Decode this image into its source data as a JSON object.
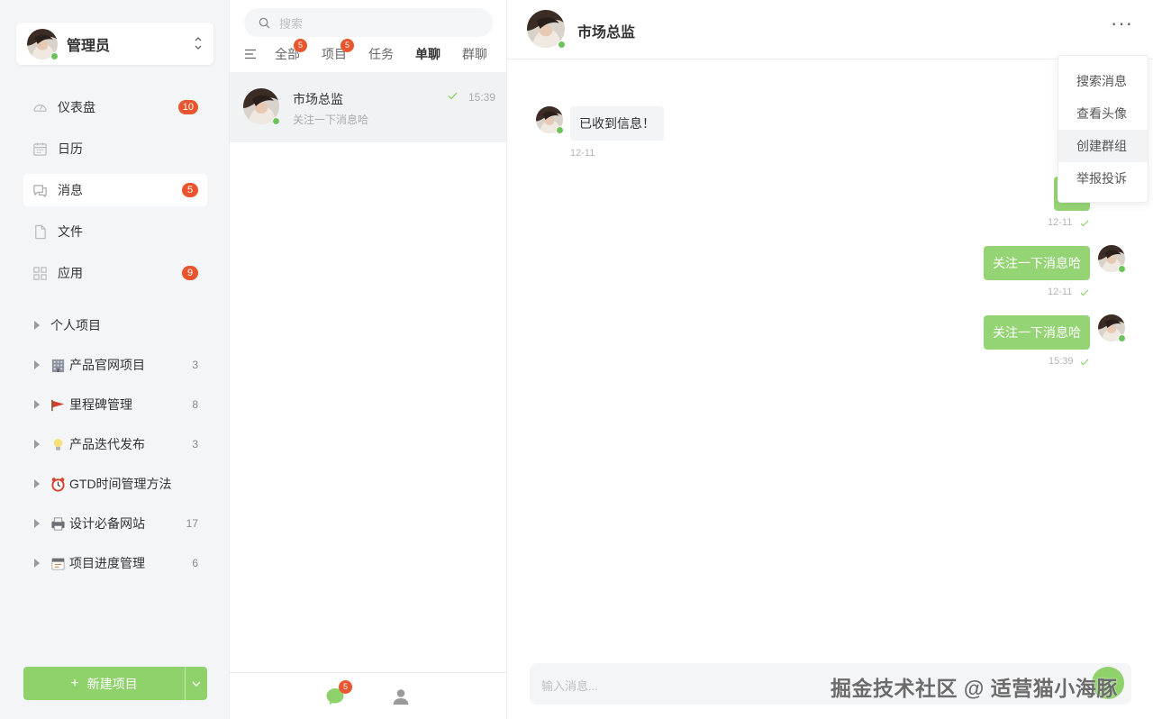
{
  "user": {
    "name": "管理员"
  },
  "nav": [
    {
      "label": "仪表盘",
      "icon": "dashboard-icon",
      "badge": "10"
    },
    {
      "label": "日历",
      "icon": "calendar-icon",
      "badge": ""
    },
    {
      "label": "消息",
      "icon": "message-icon",
      "badge": "5"
    },
    {
      "label": "文件",
      "icon": "file-icon",
      "badge": ""
    },
    {
      "label": "应用",
      "icon": "apps-icon",
      "badge": "9"
    }
  ],
  "projects": [
    {
      "label": "个人项目",
      "emoji": "",
      "count": ""
    },
    {
      "label": "产品官网项目",
      "emoji": "office-building-icon",
      "count": "3"
    },
    {
      "label": "里程碑管理",
      "emoji": "flag-icon",
      "count": "8"
    },
    {
      "label": "产品迭代发布",
      "emoji": "lightbulb-icon",
      "count": "3"
    },
    {
      "label": "GTD时间管理方法",
      "emoji": "alarm-clock-icon",
      "count": ""
    },
    {
      "label": "设计必备网站",
      "emoji": "printer-icon",
      "count": "17"
    },
    {
      "label": "项目进度管理",
      "emoji": "calendar-emoji-icon",
      "count": "6"
    }
  ],
  "new_project": {
    "label": "新建项目",
    "plus": "+"
  },
  "search": {
    "placeholder": "搜索"
  },
  "tabs": [
    {
      "label": "全部",
      "badge": "5"
    },
    {
      "label": "项目",
      "badge": "5"
    },
    {
      "label": "任务",
      "badge": ""
    },
    {
      "label": "单聊",
      "badge": ""
    },
    {
      "label": "群聊",
      "badge": ""
    }
  ],
  "conversation": {
    "name": "市场总监",
    "preview": "关注一下消息哈",
    "time": "15:39"
  },
  "footer": {
    "chat_badge": "5"
  },
  "chat": {
    "title": "市场总监",
    "more": "···",
    "messages": [
      {
        "text": "已收到信息！",
        "time": "12-11",
        "dir": "in"
      },
      {
        "text": "",
        "time": "12-11",
        "dir": "out"
      },
      {
        "text": "关注一下消息哈",
        "time": "12-11",
        "dir": "out"
      },
      {
        "text": "关注一下消息哈",
        "time": "15:39",
        "dir": "out"
      }
    ],
    "input_placeholder": "输入消息..."
  },
  "menu": [
    "搜索消息",
    "查看头像",
    "创建群组",
    "举报投诉"
  ],
  "watermark": "掘金技术社区 @ 适营猫小海豚",
  "colors": {
    "accent": "#8fd16b",
    "badge": "#e8552e",
    "online": "#6ac45a"
  }
}
